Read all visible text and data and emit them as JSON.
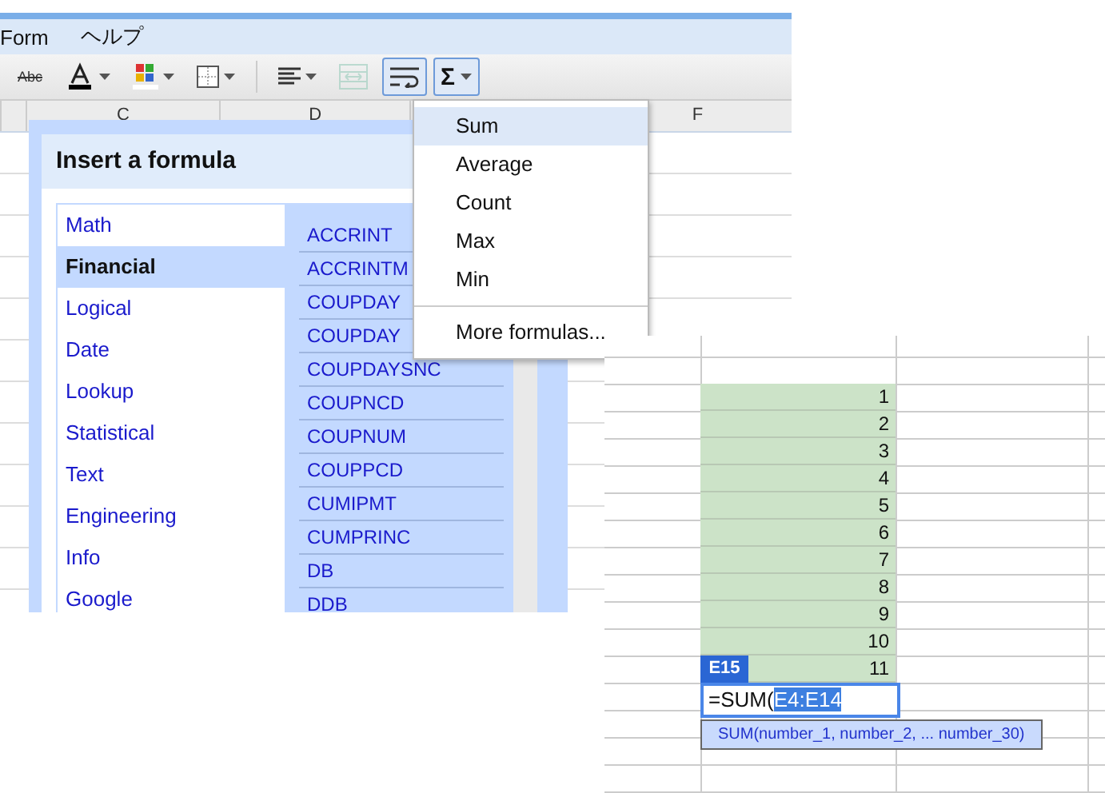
{
  "menu_bar": [
    "Form",
    "ヘルプ"
  ],
  "toolbar": [
    {
      "kind": "strike",
      "label": "Abc",
      "selected": false,
      "disabled": false
    },
    {
      "kind": "text-color",
      "selected": false,
      "disabled": false
    },
    {
      "kind": "fill-color",
      "selected": false,
      "disabled": false
    },
    {
      "kind": "borders",
      "selected": false,
      "disabled": false
    },
    {
      "kind": "align",
      "selected": false,
      "disabled": false
    },
    {
      "kind": "merge",
      "selected": false,
      "disabled": true
    },
    {
      "kind": "wrap",
      "selected": true,
      "disabled": false
    },
    {
      "kind": "sum",
      "label": "Σ",
      "selected": true,
      "disabled": false
    }
  ],
  "column_headers": [
    "C",
    "D",
    "F"
  ],
  "dialog": {
    "title": "Insert a formula",
    "categories": [
      {
        "label": "Math",
        "selected": false
      },
      {
        "label": "Financial",
        "selected": true
      },
      {
        "label": "Logical",
        "selected": false
      },
      {
        "label": "Date",
        "selected": false
      },
      {
        "label": "Lookup",
        "selected": false
      },
      {
        "label": "Statistical",
        "selected": false
      },
      {
        "label": "Text",
        "selected": false
      },
      {
        "label": "Engineering",
        "selected": false
      },
      {
        "label": "Info",
        "selected": false
      },
      {
        "label": "Google",
        "selected": false
      }
    ],
    "functions": [
      "ACCRINT",
      "ACCRINTM",
      "COUPDAY",
      "COUPDAY",
      "COUPDAYSNC",
      "COUPNCD",
      "COUPNUM",
      "COUPPCD",
      "CUMIPMT",
      "CUMPRINC",
      "DB",
      "DDB"
    ]
  },
  "formula_menu": [
    {
      "kind": "item",
      "label": "Sum",
      "selected": true
    },
    {
      "kind": "item",
      "label": "Average",
      "selected": false
    },
    {
      "kind": "item",
      "label": "Count",
      "selected": false
    },
    {
      "kind": "item",
      "label": "Max",
      "selected": false
    },
    {
      "kind": "item",
      "label": "Min",
      "selected": false
    },
    {
      "kind": "separator"
    },
    {
      "kind": "item",
      "label": "More formulas...",
      "selected": false
    }
  ],
  "sheet": {
    "values": [
      "1",
      "2",
      "3",
      "4",
      "5",
      "6",
      "7",
      "8",
      "9",
      "10",
      "11"
    ],
    "name_badge": "E15",
    "formula": {
      "text": "=SUM(",
      "selection": "E4:E14"
    },
    "tooltip": "SUM(number_1, number_2, ... number_30)"
  }
}
